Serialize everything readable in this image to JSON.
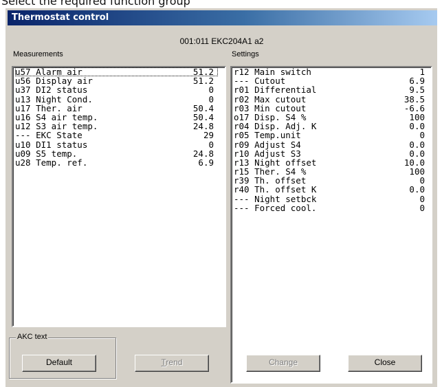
{
  "page_caption": "Select the required function group",
  "window": {
    "title": "Thermostat control",
    "device_id": "001:011  EKC204A1 a2"
  },
  "measurements": {
    "label": "Measurements",
    "rows": [
      {
        "label": "u57 Alarm air",
        "value": "51.2"
      },
      {
        "label": "u56 Display air",
        "value": "51.2"
      },
      {
        "label": "u37 DI2 status",
        "value": "0"
      },
      {
        "label": "u13 Night Cond.",
        "value": "0"
      },
      {
        "label": "u17 Ther. air",
        "value": "50.4"
      },
      {
        "label": "u16 S4 air temp.",
        "value": "50.4"
      },
      {
        "label": "u12 S3 air temp.",
        "value": "24.8"
      },
      {
        "label": "--- EKC State",
        "value": "29"
      },
      {
        "label": "u10 DI1 status",
        "value": "0"
      },
      {
        "label": "u09 S5 temp.",
        "value": "24.8"
      },
      {
        "label": "u28 Temp. ref.",
        "value": "6.9"
      }
    ]
  },
  "settings": {
    "label": "Settings",
    "rows": [
      {
        "label": "r12 Main switch",
        "value": "1"
      },
      {
        "label": "--- Cutout",
        "value": "6.9"
      },
      {
        "label": "r01 Differential",
        "value": "9.5"
      },
      {
        "label": "r02 Max cutout",
        "value": "38.5"
      },
      {
        "label": "r03 Min cutout",
        "value": "-6.6"
      },
      {
        "label": "o17 Disp. S4 %",
        "value": "100"
      },
      {
        "label": "r04 Disp. Adj. K",
        "value": "0.0"
      },
      {
        "label": "r05 Temp.unit",
        "value": "0"
      },
      {
        "label": "r09 Adjust S4",
        "value": "0.0"
      },
      {
        "label": "r10 Adjust S3",
        "value": "0.0"
      },
      {
        "label": "r13 Night offset",
        "value": "10.0"
      },
      {
        "label": "r15 Ther. S4 %",
        "value": "100"
      },
      {
        "label": "r39 Th. offset",
        "value": "0"
      },
      {
        "label": "r40 Th. offset K",
        "value": "0.0"
      },
      {
        "label": "--- Night setbck",
        "value": "0"
      },
      {
        "label": "--- Forced cool.",
        "value": "0"
      }
    ]
  },
  "akc_group": {
    "label": "AKC text"
  },
  "buttons": {
    "default": "Default",
    "trend": "Trend",
    "change": "Change",
    "close": "Close"
  }
}
